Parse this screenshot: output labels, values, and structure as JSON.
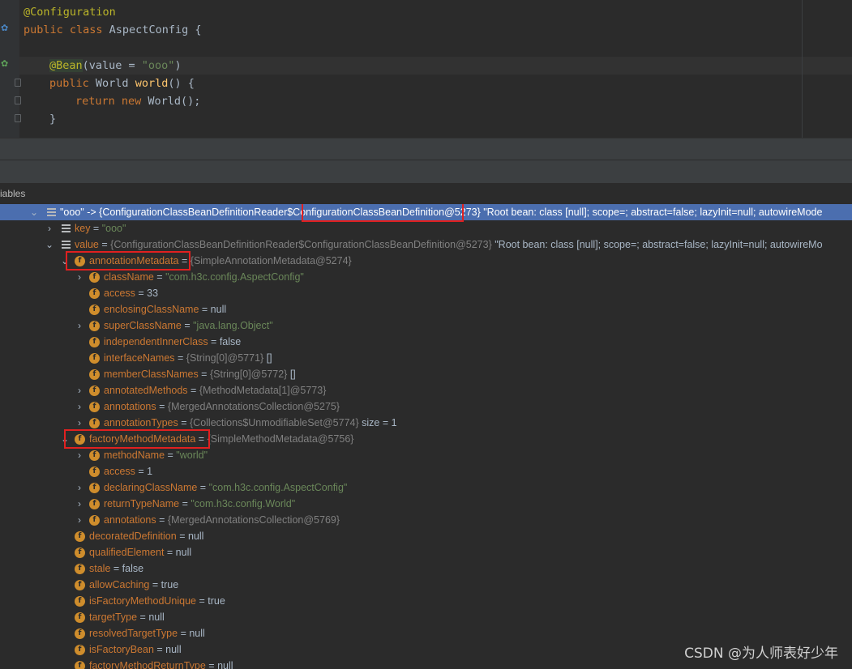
{
  "editor": {
    "lines": [
      {
        "ann": "@Configuration"
      },
      {
        "kw": "public class ",
        "name": "AspectConfig",
        "rest": " {"
      },
      {
        "ann": "@Bean",
        "open": "(value = ",
        "str": "\"ooo\"",
        "close": ")"
      },
      {
        "kw": "public ",
        "type": "World ",
        "fn": "world",
        "rest": "() {"
      },
      {
        "kw": "return new ",
        "rest": "World();"
      },
      {
        "rest": "}"
      }
    ]
  },
  "panel_title": "iables",
  "tree": {
    "root": {
      "name": "\"ooo\"",
      "value": " -> {ConfigurationClassBeanDefinitionReader$ConfigurationClassBeanDefinition@5273} \"Root bean: class [null]; scope=; abstract=false; lazyInit=null; autowireMode"
    },
    "key": {
      "name": "key",
      "eq": " = ",
      "value": "\"ooo\""
    },
    "value": {
      "name": "value",
      "eq": " = ",
      "ref": "{ConfigurationClassBeanDefinitionReader$ConfigurationClassBeanDefinition@5273}",
      "rest": " \"Root bean: class [null]; scope=; abstract=false; lazyInit=null; autowireMo"
    },
    "fields": [
      {
        "name": "annotationMetadata",
        "eq": " = ",
        "ref": "{SimpleAnnotationMetadata@5274}"
      },
      {
        "name": "className",
        "eq": " = ",
        "str": "\"com.h3c.config.AspectConfig\""
      },
      {
        "name": "access",
        "eq": " = ",
        "val": "33"
      },
      {
        "name": "enclosingClassName",
        "eq": " = ",
        "val": "null"
      },
      {
        "name": "superClassName",
        "eq": " = ",
        "str": "\"java.lang.Object\""
      },
      {
        "name": "independentInnerClass",
        "eq": " = ",
        "val": "false"
      },
      {
        "name": "interfaceNames",
        "eq": " = ",
        "ref": "{String[0]@5771}",
        "val": " []"
      },
      {
        "name": "memberClassNames",
        "eq": " = ",
        "ref": "{String[0]@5772}",
        "val": " []"
      },
      {
        "name": "annotatedMethods",
        "eq": " = ",
        "ref": "{MethodMetadata[1]@5773}"
      },
      {
        "name": "annotations",
        "eq": " = ",
        "ref": "{MergedAnnotationsCollection@5275}"
      },
      {
        "name": "annotationTypes",
        "eq": " = ",
        "ref": "{Collections$UnmodifiableSet@5774}",
        "val": "  size = 1"
      },
      {
        "name": "factoryMethodMetadata",
        "eq": " = ",
        "ref": "{SimpleMethodMetadata@5756}"
      },
      {
        "name": "methodName",
        "eq": " = ",
        "str": "\"world\""
      },
      {
        "name": "access",
        "eq": " = ",
        "val": "1"
      },
      {
        "name": "declaringClassName",
        "eq": " = ",
        "str": "\"com.h3c.config.AspectConfig\""
      },
      {
        "name": "returnTypeName",
        "eq": " = ",
        "str": "\"com.h3c.config.World\""
      },
      {
        "name": "annotations",
        "eq": " = ",
        "ref": "{MergedAnnotationsCollection@5769}"
      },
      {
        "name": "decoratedDefinition",
        "eq": " = ",
        "val": "null"
      },
      {
        "name": "qualifiedElement",
        "eq": " = ",
        "val": "null"
      },
      {
        "name": "stale",
        "eq": " = ",
        "val": "false"
      },
      {
        "name": "allowCaching",
        "eq": " = ",
        "val": "true"
      },
      {
        "name": "isFactoryMethodUnique",
        "eq": " = ",
        "val": "true"
      },
      {
        "name": "targetType",
        "eq": " = ",
        "val": "null"
      },
      {
        "name": "resolvedTargetType",
        "eq": " = ",
        "val": "null"
      },
      {
        "name": "isFactoryBean",
        "eq": " = ",
        "val": "null"
      },
      {
        "name": "factoryMethodReturnType",
        "eq": " = ",
        "val": "null"
      }
    ]
  },
  "watermark": "CSDN @为人师表好少年",
  "colors": {
    "selection": "#4b6eaf",
    "highlight_box": "#e02020",
    "field_icon": "#cf8d2c"
  }
}
